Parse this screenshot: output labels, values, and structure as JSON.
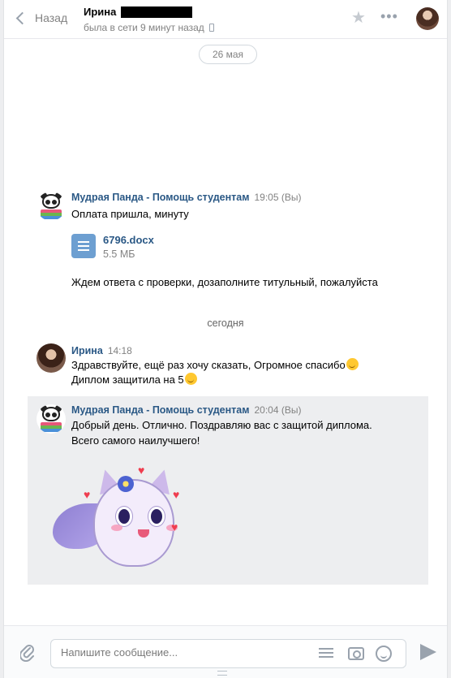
{
  "header": {
    "back_label": "Назад",
    "peer_name": "Ирина",
    "peer_status": "была в сети 9 минут назад"
  },
  "date_pill": "26 мая",
  "messages": [
    {
      "author": "Мудрая Панда - Помощь студентам",
      "time": "19:05 (Вы)",
      "text": "Оплата пришла, минуту",
      "doc": {
        "name": "6796.docx",
        "size": "5.5 МБ"
      },
      "text2": "Ждем ответа с проверки, дозаполните титульный, пожалуйста"
    },
    {
      "author": "Ирина",
      "time": "14:18",
      "line1": "Здравствуйте, ещё раз хочу сказать, Огромное спасибо",
      "line2": "Диплом защитила на 5"
    },
    {
      "author": "Мудрая Панда - Помощь студентам",
      "time": "20:04 (Вы)",
      "line1": "Добрый день. Отлично. Поздравляю вас с защитой диплома.",
      "line2": "Всего самого наилучшего!"
    }
  ],
  "day_separator": "сегодня",
  "compose": {
    "placeholder": "Напишите сообщение..."
  }
}
